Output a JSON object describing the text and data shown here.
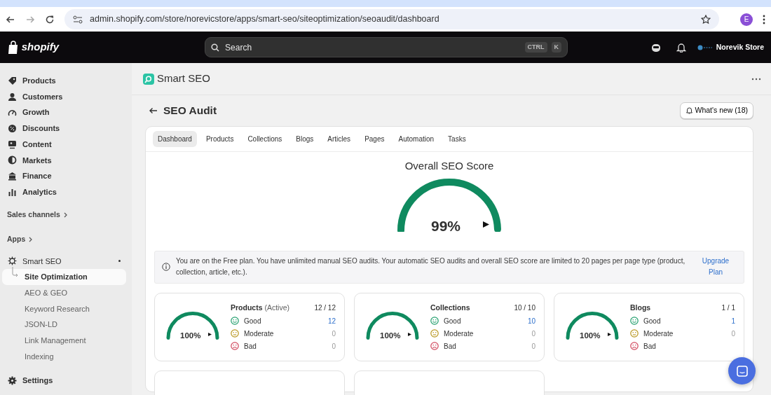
{
  "browser": {
    "url": "admin.shopify.com/store/norevicstore/apps/smart-seo/siteoptimization/seoaudit/dashboard",
    "profile_initial": "E"
  },
  "topbar": {
    "logo": "shopify",
    "search": {
      "placeholder": "Search",
      "shortcut": [
        "CTRL",
        "K"
      ]
    },
    "store": "Norevik Store"
  },
  "sidebar": {
    "items": [
      {
        "kind": "nav",
        "label": "Products"
      },
      {
        "kind": "nav",
        "label": "Customers"
      },
      {
        "kind": "nav",
        "label": "Growth"
      },
      {
        "kind": "nav",
        "label": "Discounts"
      },
      {
        "kind": "nav",
        "label": "Content"
      },
      {
        "kind": "nav",
        "label": "Markets"
      },
      {
        "kind": "nav",
        "label": "Finance"
      },
      {
        "kind": "nav",
        "label": "Analytics"
      },
      {
        "kind": "section",
        "label": "Sales channels"
      },
      {
        "kind": "section",
        "label": "Apps"
      },
      {
        "kind": "app",
        "label": "Smart SEO"
      },
      {
        "kind": "sub",
        "label": "Site Optimization",
        "selected": true
      },
      {
        "kind": "sub",
        "label": "AEO & GEO",
        "selected": false
      },
      {
        "kind": "sub",
        "label": "Keyword Research",
        "selected": false
      },
      {
        "kind": "sub",
        "label": "JSON-LD",
        "selected": false
      },
      {
        "kind": "sub",
        "label": "Link Management",
        "selected": false
      },
      {
        "kind": "sub",
        "label": "Indexing",
        "selected": false
      },
      {
        "kind": "settings",
        "label": "Settings"
      }
    ]
  },
  "app_title": "Smart SEO",
  "page": {
    "title": "SEO Audit",
    "whats_new": "What's new (18)"
  },
  "tabs": [
    {
      "label": "Dashboard",
      "selected": true
    },
    {
      "label": "Products",
      "selected": false
    },
    {
      "label": "Collections",
      "selected": false
    },
    {
      "label": "Blogs",
      "selected": false
    },
    {
      "label": "Articles",
      "selected": false
    },
    {
      "label": "Pages",
      "selected": false
    },
    {
      "label": "Automation",
      "selected": false
    },
    {
      "label": "Tasks",
      "selected": false
    }
  ],
  "score": {
    "title": "Overall SEO Score",
    "level": 0.99,
    "value": "99%"
  },
  "banner": {
    "text": "You are on the Free plan. You have unlimited manual SEO audits. Your automatic SEO audits and overall SEO score are limited to 20 pages per page type (product, collection, article, etc.).",
    "link": "Upgrade Plan"
  },
  "cards": [
    {
      "title": "Products",
      "note": "(Active)",
      "count": "12 / 12",
      "level": 1,
      "percent": "100%",
      "rows": [
        {
          "kind": "good",
          "label": "Good",
          "value": "12"
        },
        {
          "kind": "moderate",
          "label": "Moderate",
          "value": "0"
        },
        {
          "kind": "bad",
          "label": "Bad",
          "value": "0"
        }
      ]
    },
    {
      "title": "Collections",
      "count": "10 / 10",
      "level": 1,
      "percent": "100%",
      "rows": [
        {
          "kind": "good",
          "label": "Good",
          "value": "10"
        },
        {
          "kind": "moderate",
          "label": "Moderate",
          "value": "0"
        },
        {
          "kind": "bad",
          "label": "Bad",
          "value": "0"
        }
      ]
    },
    {
      "title": "Blogs",
      "count": "1 / 1",
      "level": 1,
      "percent": "100%",
      "rows": [
        {
          "kind": "good",
          "label": "Good",
          "value": "1"
        },
        {
          "kind": "moderate",
          "label": "Moderate",
          "value": "0"
        },
        {
          "kind": "bad",
          "label": "Bad"
        }
      ]
    }
  ]
}
